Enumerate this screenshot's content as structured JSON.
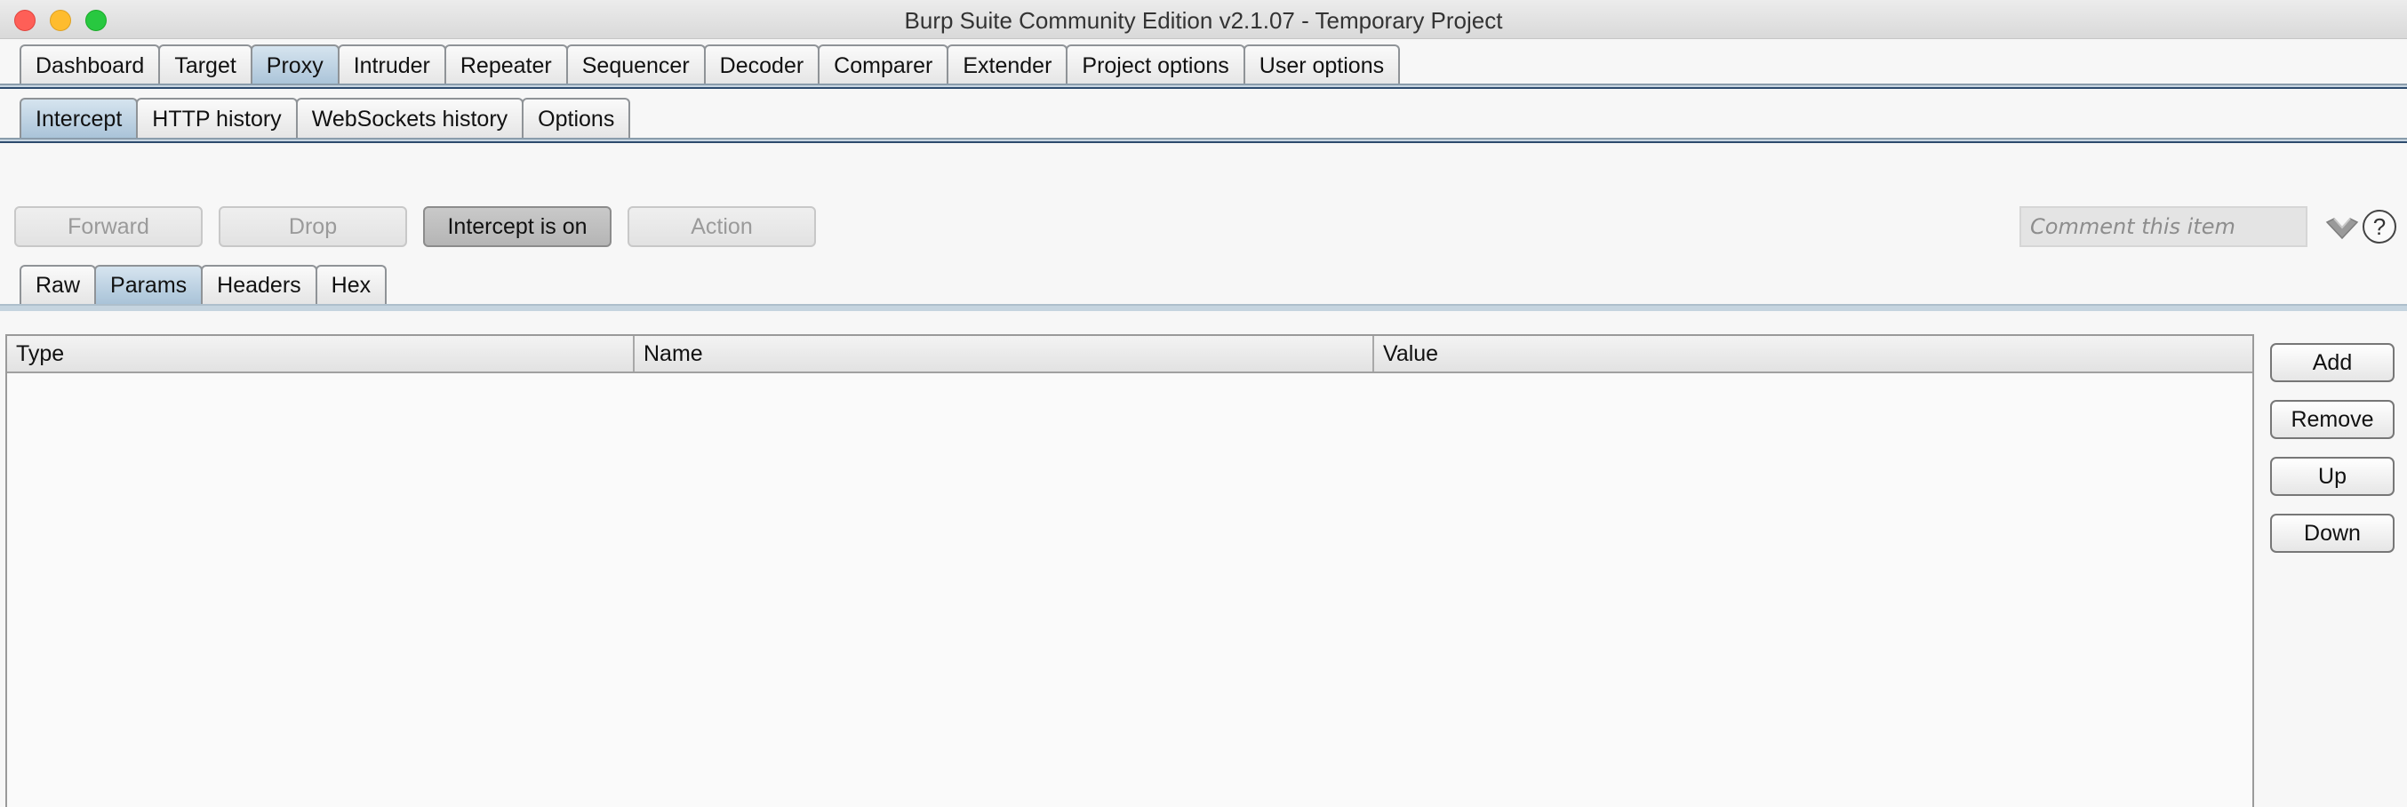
{
  "window": {
    "title": "Burp Suite Community Edition v2.1.07 - Temporary Project"
  },
  "main_tabs": [
    "Dashboard",
    "Target",
    "Proxy",
    "Intruder",
    "Repeater",
    "Sequencer",
    "Decoder",
    "Comparer",
    "Extender",
    "Project options",
    "User options"
  ],
  "main_tab_active": "Proxy",
  "sub_tabs": [
    "Intercept",
    "HTTP history",
    "WebSockets history",
    "Options"
  ],
  "sub_tab_active": "Intercept",
  "toolbar": {
    "forward": "Forward",
    "drop": "Drop",
    "intercept": "Intercept is on",
    "action": "Action",
    "comment_placeholder": "Comment this item",
    "help": "?"
  },
  "view_tabs": [
    "Raw",
    "Params",
    "Headers",
    "Hex"
  ],
  "view_tab_active": "Params",
  "params_table": {
    "columns": [
      "Type",
      "Name",
      "Value"
    ],
    "rows": []
  },
  "side_buttons": {
    "add": "Add",
    "remove": "Remove",
    "up": "Up",
    "down": "Down"
  },
  "colors": {
    "active_tab": "#a9c3d8",
    "band": "#2d4b6e",
    "close": "#fe5f57",
    "minimize": "#febc2e",
    "maximize": "#28c840"
  },
  "icons": [
    "close-icon",
    "minimize-icon",
    "maximize-icon",
    "highlight-icon",
    "help-icon"
  ]
}
